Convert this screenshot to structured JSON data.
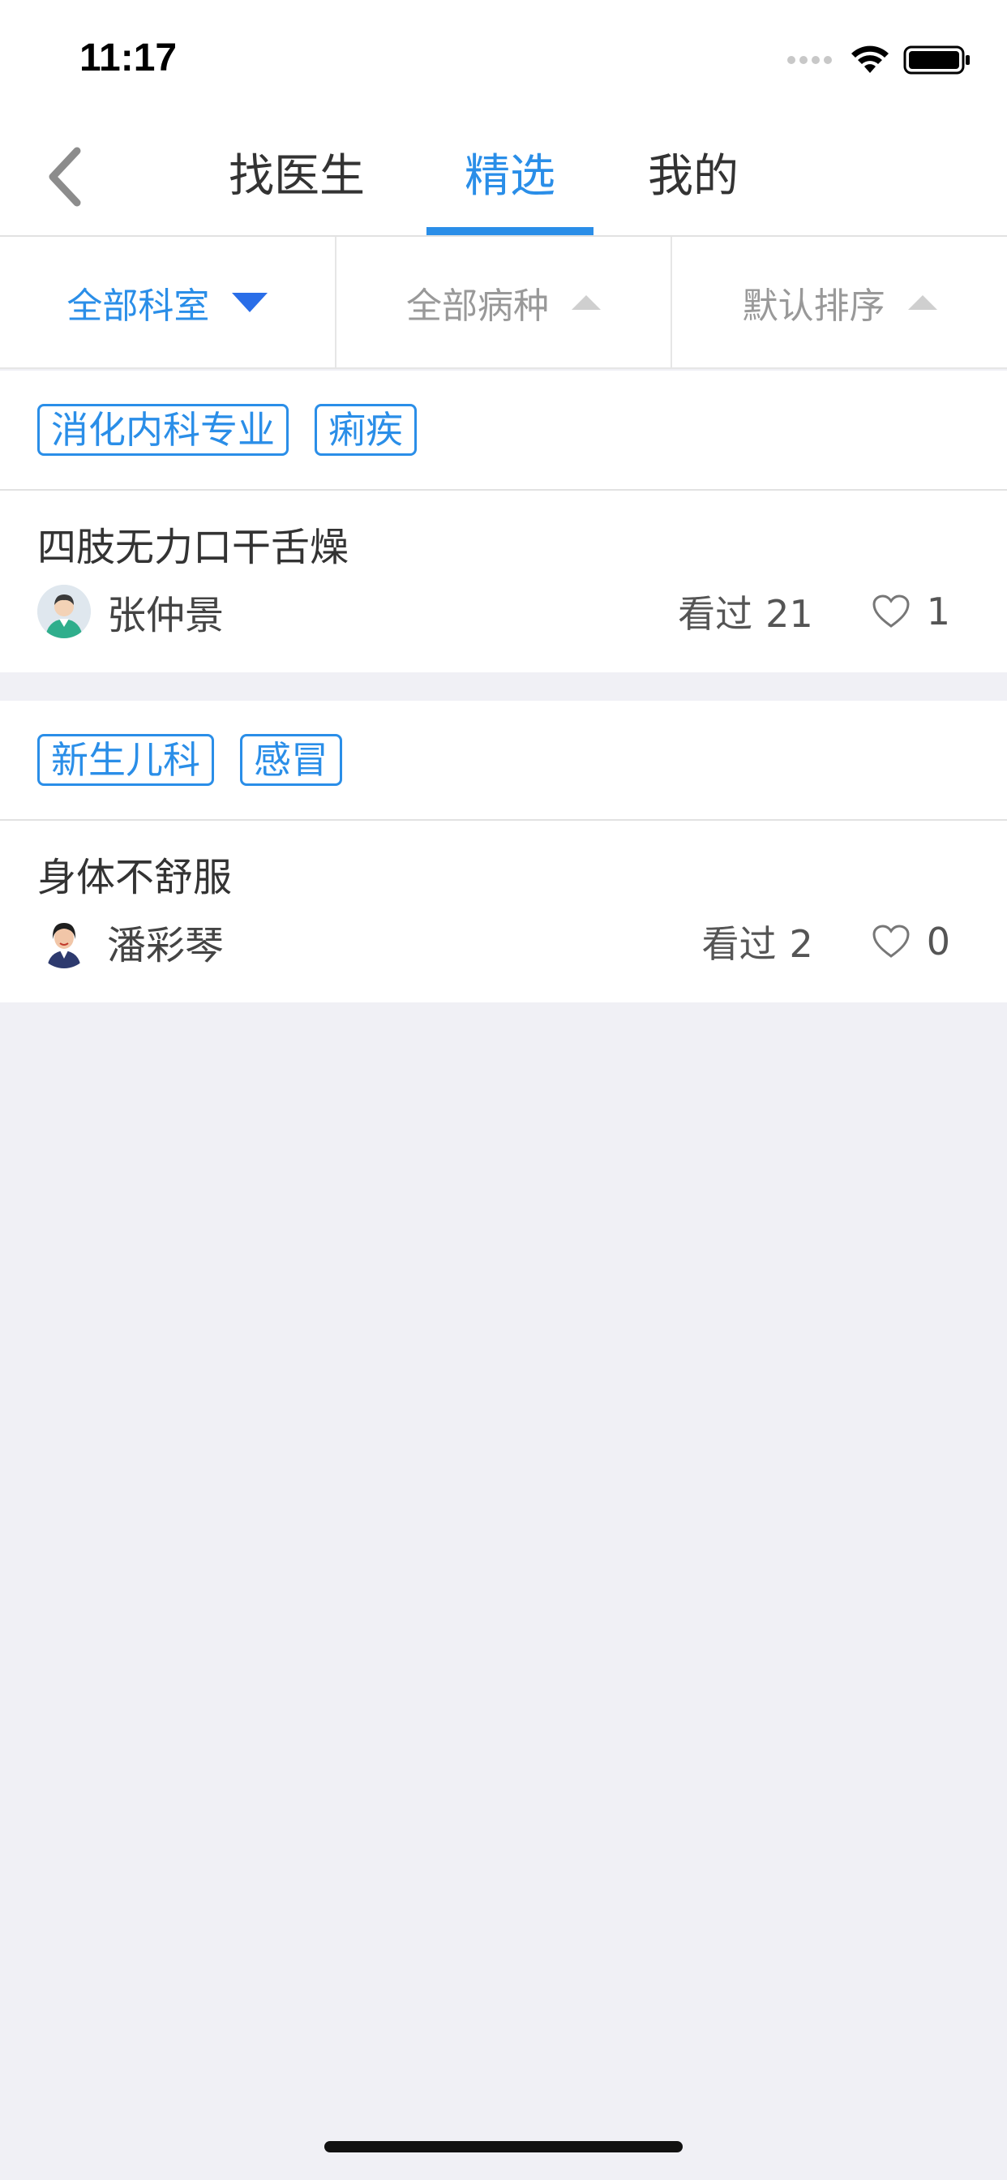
{
  "status_bar": {
    "time": "11:17"
  },
  "nav": {
    "tabs": [
      {
        "label": "找医生",
        "active": false
      },
      {
        "label": "精选",
        "active": true
      },
      {
        "label": "我的",
        "active": false
      }
    ]
  },
  "filters": [
    {
      "label": "全部科室",
      "active": true
    },
    {
      "label": "全部病种",
      "active": false
    },
    {
      "label": "默认排序",
      "active": false
    }
  ],
  "posts": [
    {
      "tags": [
        "消化内科专业",
        "痢疾"
      ],
      "title": "四肢无力口干舌燥",
      "author": "张仲景",
      "views_label": "看过",
      "views": "21",
      "likes": "1"
    },
    {
      "tags": [
        "新生儿科",
        "感冒"
      ],
      "title": "身体不舒服",
      "author": "潘彩琴",
      "views_label": "看过",
      "views": "2",
      "likes": "0"
    }
  ],
  "colors": {
    "accent": "#2a8ee8",
    "background": "#f0f0f5",
    "card": "#ffffff",
    "text_primary": "#333333",
    "text_muted": "#999999"
  }
}
